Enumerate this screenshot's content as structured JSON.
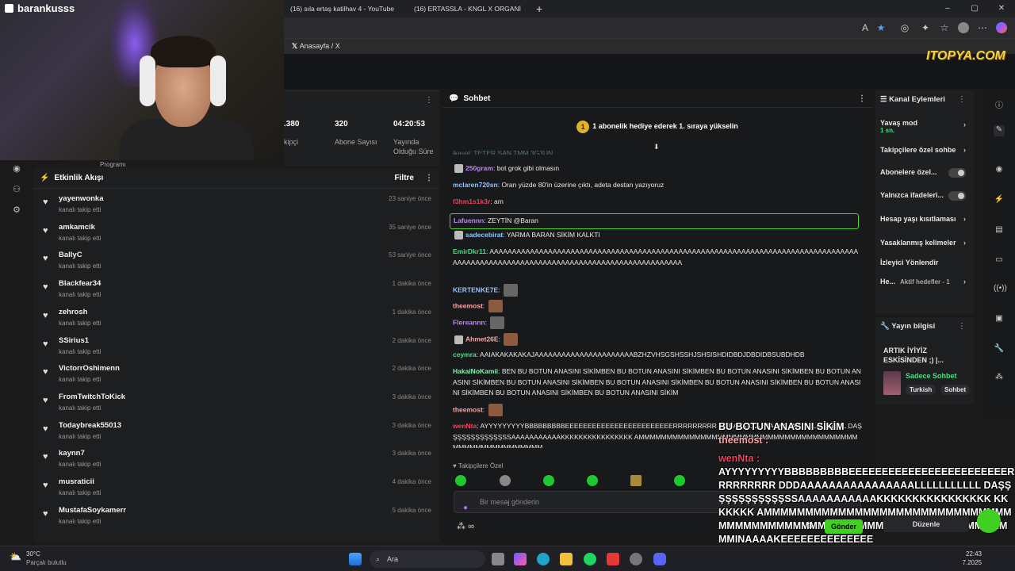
{
  "webcam": {
    "streamer_name": "barankusss"
  },
  "browser": {
    "tabs": [
      {
        "title": "(16) sıla ertaş katilhav 4 - YouTube"
      },
      {
        "title": "(16) ERTASSLA - KNGL X ORGANİ"
      }
    ],
    "new_tab": "+",
    "bookmark": "Anasayfa / X",
    "window_controls": [
      "–",
      "▢",
      "✕"
    ],
    "toolbar_icons": [
      "read-aloud-icon",
      "star-icon",
      "extensions-icon",
      "puzzle-icon",
      "favorites-icon",
      "profile-icon",
      "menu-icon",
      "copilot-icon"
    ]
  },
  "overlay_logo": "ITOPYA.COM",
  "stats": [
    {
      "value": ".380",
      "label": "kipçi"
    },
    {
      "value": "320",
      "label": "Abone Sayısı"
    },
    {
      "value": "04:20:53",
      "label": "Yayında Olduğu Süre"
    }
  ],
  "stats_partial": "Programı",
  "activity": {
    "title": "Etkinlik Akışı",
    "filter": "Filtre",
    "items": [
      {
        "name": "yayenwonka",
        "sub": "kanalı takip etti",
        "time": "23 saniye önce"
      },
      {
        "name": "amkamcik",
        "sub": "kanalı takip etti",
        "time": "35 saniye önce"
      },
      {
        "name": "BallyC",
        "sub": "kanalı takip etti",
        "time": "53 saniye önce"
      },
      {
        "name": "Blackfear34",
        "sub": "kanalı takip etti",
        "time": "1 dakika önce"
      },
      {
        "name": "zehrosh",
        "sub": "kanalı takip etti",
        "time": "1 dakika önce"
      },
      {
        "name": "SSirius1",
        "sub": "kanalı takip etti",
        "time": "2 dakika önce"
      },
      {
        "name": "VictorrOshimenn",
        "sub": "kanalı takip etti",
        "time": "2 dakika önce"
      },
      {
        "name": "FromTwitchToKick",
        "sub": "kanalı takip etti",
        "time": "3 dakika önce"
      },
      {
        "name": "Todaybreak55013",
        "sub": "kanalı takip etti",
        "time": "3 dakika önce"
      },
      {
        "name": "kaynn7",
        "sub": "kanalı takip etti",
        "time": "3 dakika önce"
      },
      {
        "name": "musraticii",
        "sub": "kanalı takip etti",
        "time": "4 dakika önce"
      },
      {
        "name": "MustafaSoykamerr",
        "sub": "kanalı takip etti",
        "time": "5 dakika önce"
      }
    ]
  },
  "chat": {
    "title": "Sohbet",
    "pinned": "1 abonelik hediye ederek 1. sıraya yükselin",
    "pinned_badge": "1",
    "messages": [
      {
        "user": "250gram",
        "color": "#c084fc",
        "text": "bot grok gibi olmasın"
      },
      {
        "user": "mclaren720sn",
        "color": "#93c5fd",
        "text": "Oran yüzde 80'in üzerine çıktı, adeta destan yazıyoruz"
      },
      {
        "user": "f3hm1s1k3r",
        "color": "#f43f5e",
        "text": "am"
      },
      {
        "user": "Lafuennn",
        "color": "#c084fc",
        "text": "ZEYTİN @Baran"
      },
      {
        "user": "sadecebirat",
        "color": "#93c5fd",
        "text": "YARMA BARAN SİKİM KALKTI"
      },
      {
        "user": "EmirDkr11",
        "color": "#4ade80",
        "text": "AAAAAAAAAAAAAAAAAAAAAAAAAAAAAAAAAAAAAAAAAAAAAAAAAAAAAAAAAAAAAAAAAAAAAAAAAAAAAAAAAAAAAAAAAAAAAAAAAAAAAAAAAAAAAAAAAAAAAAAAAAAAAAAAAAAAA"
      },
      {
        "user": "KERTENKE7E",
        "color": "#93c5fd",
        "text": ""
      },
      {
        "user": "theemost",
        "color": "#fca5a5",
        "text": ""
      },
      {
        "user": "Flereannn",
        "color": "#c084fc",
        "text": ""
      },
      {
        "user": "Ahmet26E",
        "color": "#fca5a5",
        "text": ""
      },
      {
        "user": "ceymra",
        "color": "#4ade80",
        "text": "AAIAKAKAKAKAJAAAAAAAAAAAAAAAAAAAAAABZHZVHSGSHSSHJSHSISHDIDBDJDBDIDBSUBDHDB"
      },
      {
        "user": "HakaiNoKamii",
        "color": "#86efac",
        "text": "BEN BU BOTUN ANASINI SİKİMBEN BU BOTUN ANASINI SİKİMBEN BU BOTUN ANASINI SİKİMBEN BU BOTUN ANASINI SİKİMBEN BU BOTUN ANASINI SİKİMBEN BU BOTUN ANASINI SİKİMBEN BU BOTUN ANASINI SİKİMBEN BU BOTUN ANASINI SİKİMBEN BU BOTUN ANASINI SİKİMBEN BU BOTUN ANASINI SİKİM"
      },
      {
        "user": "theemost",
        "color": "#fca5a5",
        "text": ""
      },
      {
        "user": "wenNta",
        "color": "#f43f5e",
        "text": "AYYYYYYYYYBBBBBBBBBEEEEEEEEEEEEEEEEEEEEEEEERRRRRRRRR DDDAAAAAAAAAAAAAAAALLLLLLLLLLL DAŞŞŞŞŞŞŞŞŞŞŞŞSSAAAAAAAAAAAKKKKKKKKKKKKKKKK AMMMMMMMMMMMMMMMMMMMMMMMMMMMMMMMMMMMMMMMMMMMMMMMMMMMMMMM"
      }
    ],
    "partial_top": "ikayal: TETER ŞAN TMM 3G3UN",
    "followers_only": "Takipçilere Özel",
    "input_placeholder": "Bir mesaj gönderin",
    "infinity": "∞"
  },
  "channel_actions": {
    "title": "Kanal Eylemleri",
    "items": [
      {
        "label": "Yavaş mod",
        "sub": "1 sn.",
        "type": "chevron"
      },
      {
        "label": "Takipçilere özel sohbe",
        "type": "chevron"
      },
      {
        "label": "Abonelere özel...",
        "type": "toggle"
      },
      {
        "label": "Yalnızca ifadeleri...",
        "type": "toggle"
      },
      {
        "label": "Hesap yaşı kısıtlaması",
        "type": "chevron"
      },
      {
        "label": "Yasaklanmış kelimeler",
        "type": "chevron"
      },
      {
        "label": "İzleyici Yönlendir",
        "type": "none"
      },
      {
        "label": "He...",
        "sub": "Aktif hedefler - 1",
        "type": "chevron"
      }
    ]
  },
  "stream_info": {
    "title": "Yayın bilgisi",
    "stream_title": "ARTIK İYİYİZ ESKİSİNDEN ;) |...",
    "category": "Sadece Sohbet",
    "tags": [
      "Turkish",
      "Sohbet"
    ]
  },
  "overlay_text": {
    "line1": "BU BOTUN ANASINI SİKİM",
    "line2": "theemost :",
    "line3": "wenNta :",
    "line4": "AYYYYYYYYYBBBBBBBBBEEEEEEEEEEEEEEEEEEEEEEEERRRRRRRRR DDDAAAAAAAAAAAAAAAALLLLLLLLLLL DAŞŞŞŞŞŞŞŞŞŞŞŞSSAAAAAAAAAAAKKKKKKKKKKKKKKKK KKKKKKK AMMMMMMMMMMMMMMMMMMMMMMMMMMMMMMMMMMMMMMMMMMMMMMMMMMMMMMMMMMMMMMMMMMMINAAAAKEEEEEEEEEEEEEE",
    "send": "Gönder",
    "edit": "Düzenle"
  },
  "taskbar": {
    "weather_temp": "30°C",
    "weather_desc": "Parçalı bulutlu",
    "search": "Ara",
    "time": "22:43",
    "date": "7.2025"
  }
}
